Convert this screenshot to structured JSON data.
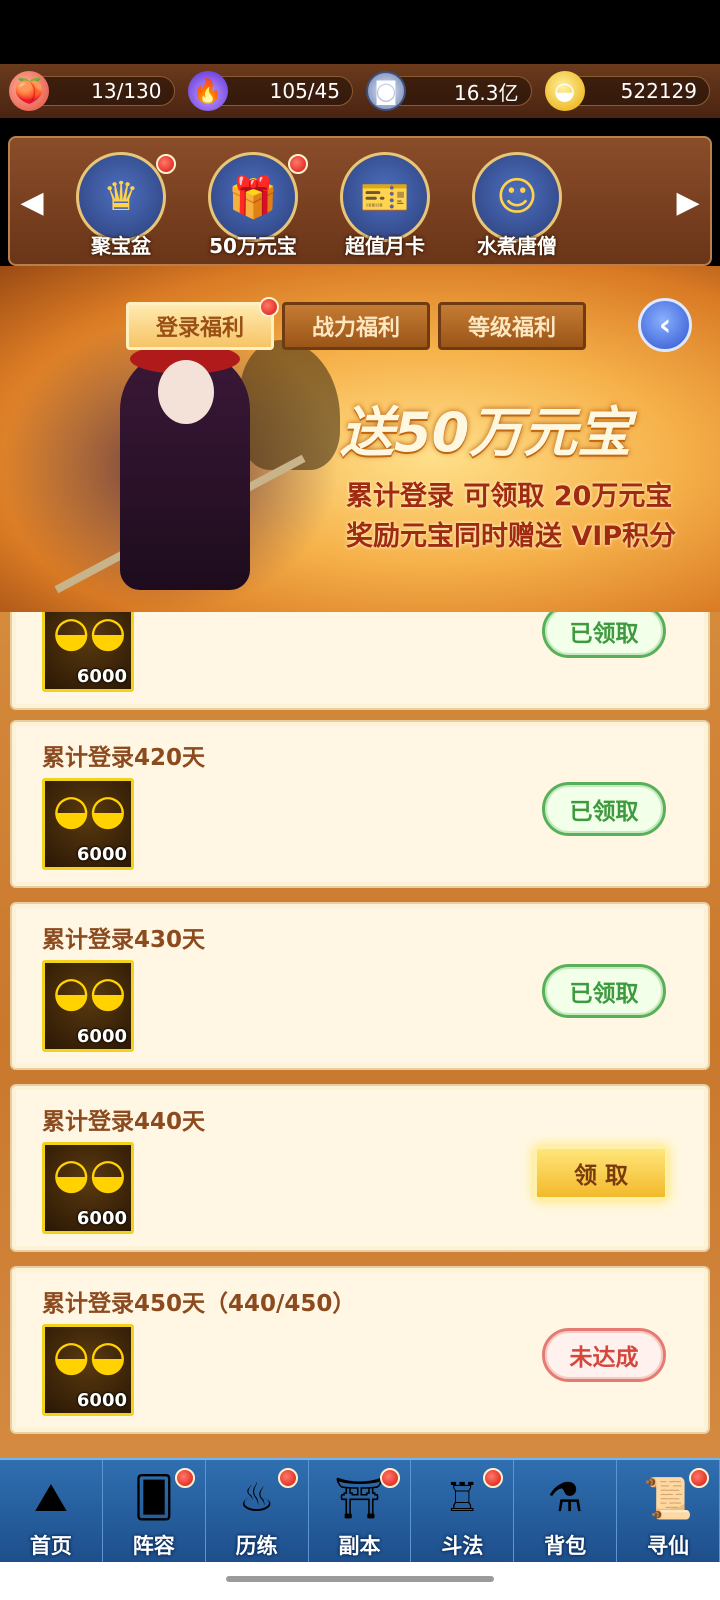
{
  "currencies": [
    {
      "icon": "peach-icon",
      "value": "13/130"
    },
    {
      "icon": "purple-flame-icon",
      "value": "105/45"
    },
    {
      "icon": "copper-coin-icon",
      "value": "16.3亿"
    },
    {
      "icon": "gold-ingot-icon",
      "value": "522129"
    }
  ],
  "activities": [
    {
      "label": "聚宝盆",
      "has_dot": true
    },
    {
      "label": "50万元宝",
      "has_dot": true
    },
    {
      "label": "超值月卡",
      "has_dot": false
    },
    {
      "label": "水煮唐僧",
      "has_dot": false
    }
  ],
  "tabs": [
    {
      "label": "登录福利",
      "active": true
    },
    {
      "label": "战力福利",
      "active": false
    },
    {
      "label": "等级福利",
      "active": false
    }
  ],
  "banner": {
    "title": "送50万元宝",
    "line1": "累计登录 可领取 20万元宝",
    "line2": "奖励元宝同时赠送 VIP积分"
  },
  "rewards": [
    {
      "title": "",
      "amount": "6000",
      "button": "已领取",
      "state": "claimed"
    },
    {
      "title": "累计登录420天",
      "amount": "6000",
      "button": "已领取",
      "state": "claimed"
    },
    {
      "title": "累计登录430天",
      "amount": "6000",
      "button": "已领取",
      "state": "claimed"
    },
    {
      "title": "累计登录440天",
      "amount": "6000",
      "button": "领 取",
      "state": "claimable"
    },
    {
      "title": "累计登录450天（440/450）",
      "amount": "6000",
      "button": "未达成",
      "state": "not-reached"
    }
  ],
  "nav": [
    {
      "label": "首页",
      "has_dot": false
    },
    {
      "label": "阵容",
      "has_dot": true
    },
    {
      "label": "历练",
      "has_dot": true
    },
    {
      "label": "副本",
      "has_dot": true
    },
    {
      "label": "斗法",
      "has_dot": true
    },
    {
      "label": "背包",
      "has_dot": false
    },
    {
      "label": "寻仙",
      "has_dot": true
    }
  ]
}
